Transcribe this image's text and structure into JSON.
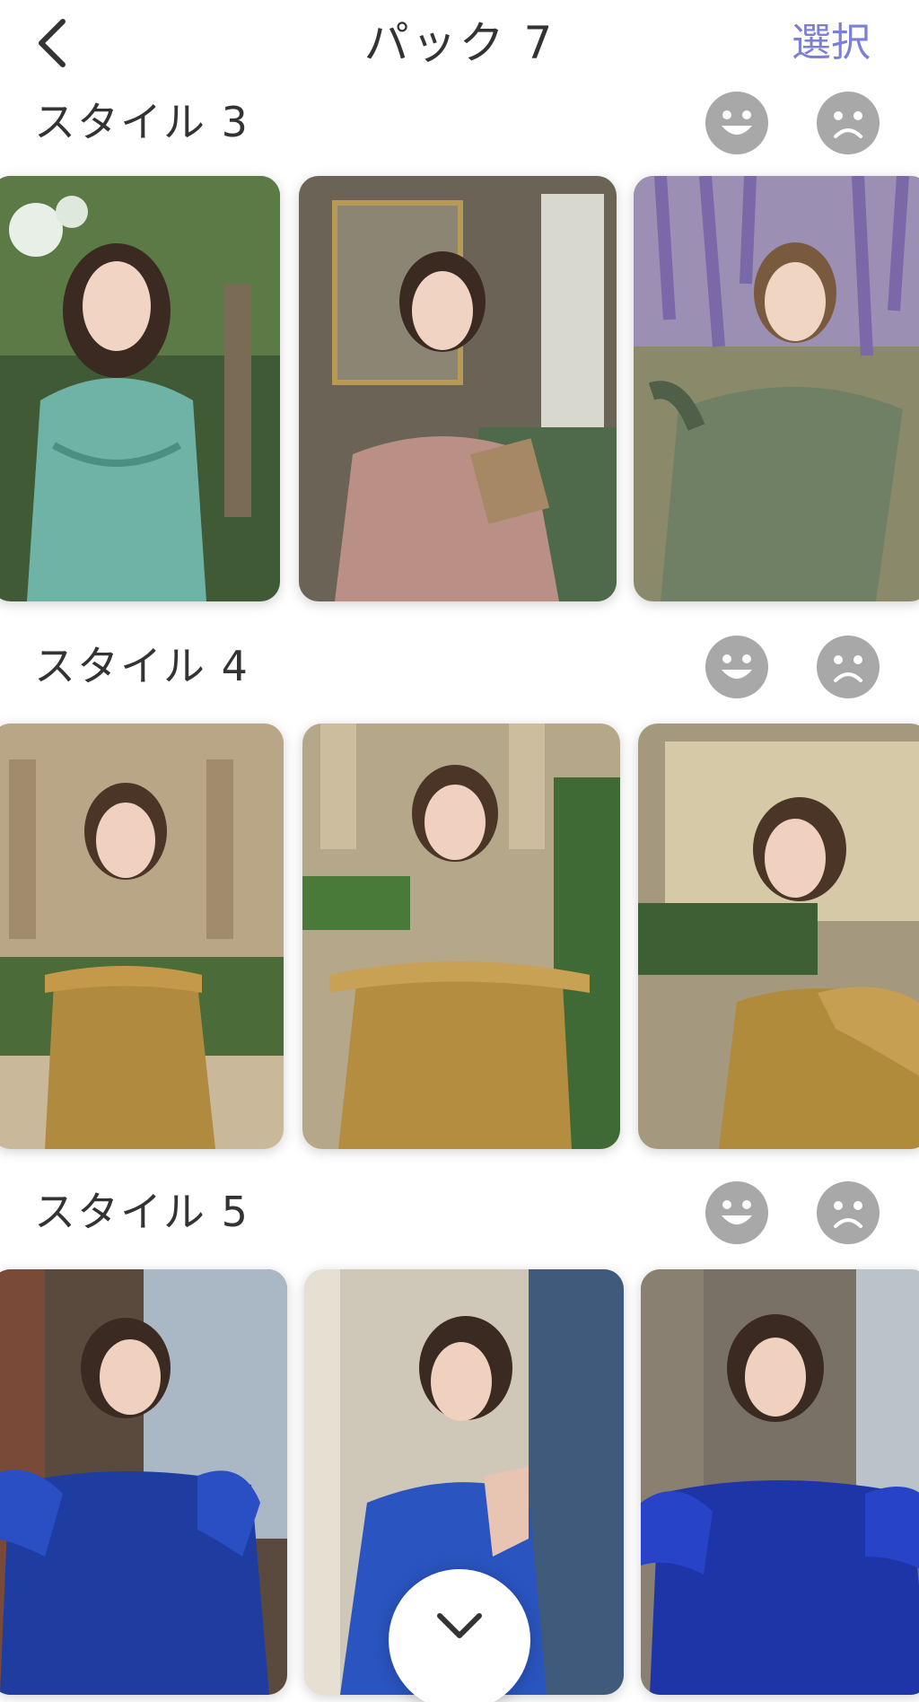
{
  "header": {
    "title": "パック 7",
    "select_label": "選択",
    "back_icon": "chevron-left-icon"
  },
  "sections": [
    {
      "title": "スタイル 3",
      "like_icon": "happy-face-icon",
      "dislike_icon": "sad-face-icon"
    },
    {
      "title": "スタイル 4",
      "like_icon": "happy-face-icon",
      "dislike_icon": "sad-face-icon"
    },
    {
      "title": "スタイル 5",
      "like_icon": "happy-face-icon",
      "dislike_icon": "sad-face-icon"
    }
  ],
  "scroll_button": {
    "icon": "chevron-down-icon"
  },
  "colors": {
    "accent": "#7b7fd6",
    "face_button": "#a8a8a8",
    "text": "#333333"
  }
}
